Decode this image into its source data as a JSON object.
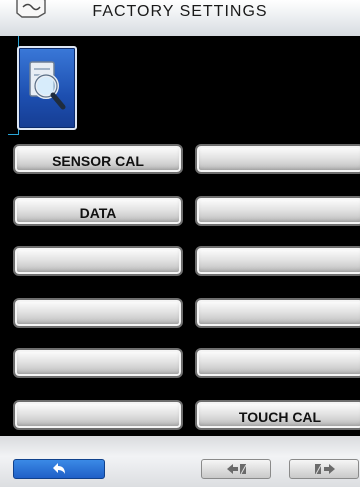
{
  "header": {
    "title": "FACTORY SETTINGS",
    "logo_icon": "logo-icon"
  },
  "search_button": {
    "icon": "search-icon"
  },
  "buttons": {
    "left": [
      {
        "label": "SENSOR CAL"
      },
      {
        "label": "DATA"
      },
      {
        "label": ""
      },
      {
        "label": ""
      },
      {
        "label": ""
      },
      {
        "label": ""
      }
    ],
    "right": [
      {
        "label": ""
      },
      {
        "label": ""
      },
      {
        "label": ""
      },
      {
        "label": ""
      },
      {
        "label": ""
      },
      {
        "label": "TOUCH CAL"
      }
    ]
  },
  "footer": {
    "back_icon": "back-arrow-icon",
    "prev_icon": "previous-page-icon",
    "next_icon": "next-page-icon"
  },
  "colors": {
    "accent_blue": "#2a6fdc",
    "leader_line": "#2aa5d6"
  }
}
